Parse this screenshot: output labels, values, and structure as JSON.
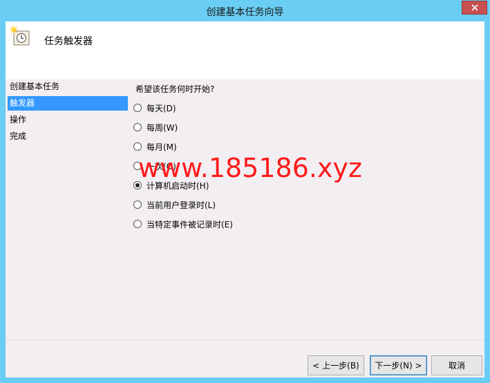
{
  "window": {
    "title": "创建基本任务向导"
  },
  "header": {
    "title": "任务触发器",
    "icon": "task-clock-icon"
  },
  "sidebar": {
    "items": [
      {
        "label": "创建基本任务",
        "active": false
      },
      {
        "label": "触发器",
        "active": true
      },
      {
        "label": "操作",
        "active": false
      },
      {
        "label": "完成",
        "active": false
      }
    ]
  },
  "main": {
    "question": "希望该任务何时开始?",
    "options": [
      {
        "label": "每天(D)",
        "checked": false
      },
      {
        "label": "每周(W)",
        "checked": false
      },
      {
        "label": "每月(M)",
        "checked": false
      },
      {
        "label": "一次(O)",
        "checked": false
      },
      {
        "label": "计算机启动时(H)",
        "checked": true
      },
      {
        "label": "当前用户登录时(L)",
        "checked": false
      },
      {
        "label": "当特定事件被记录时(E)",
        "checked": false
      }
    ]
  },
  "watermark": "www.185186.xyz",
  "buttons": {
    "back": "< 上一步(B)",
    "next": "下一步(N) >",
    "cancel": "取消"
  },
  "colors": {
    "titlebar": "#6acdf3",
    "close": "#c7504f",
    "selection": "#3399ff",
    "watermark": "#ff1a1a"
  }
}
